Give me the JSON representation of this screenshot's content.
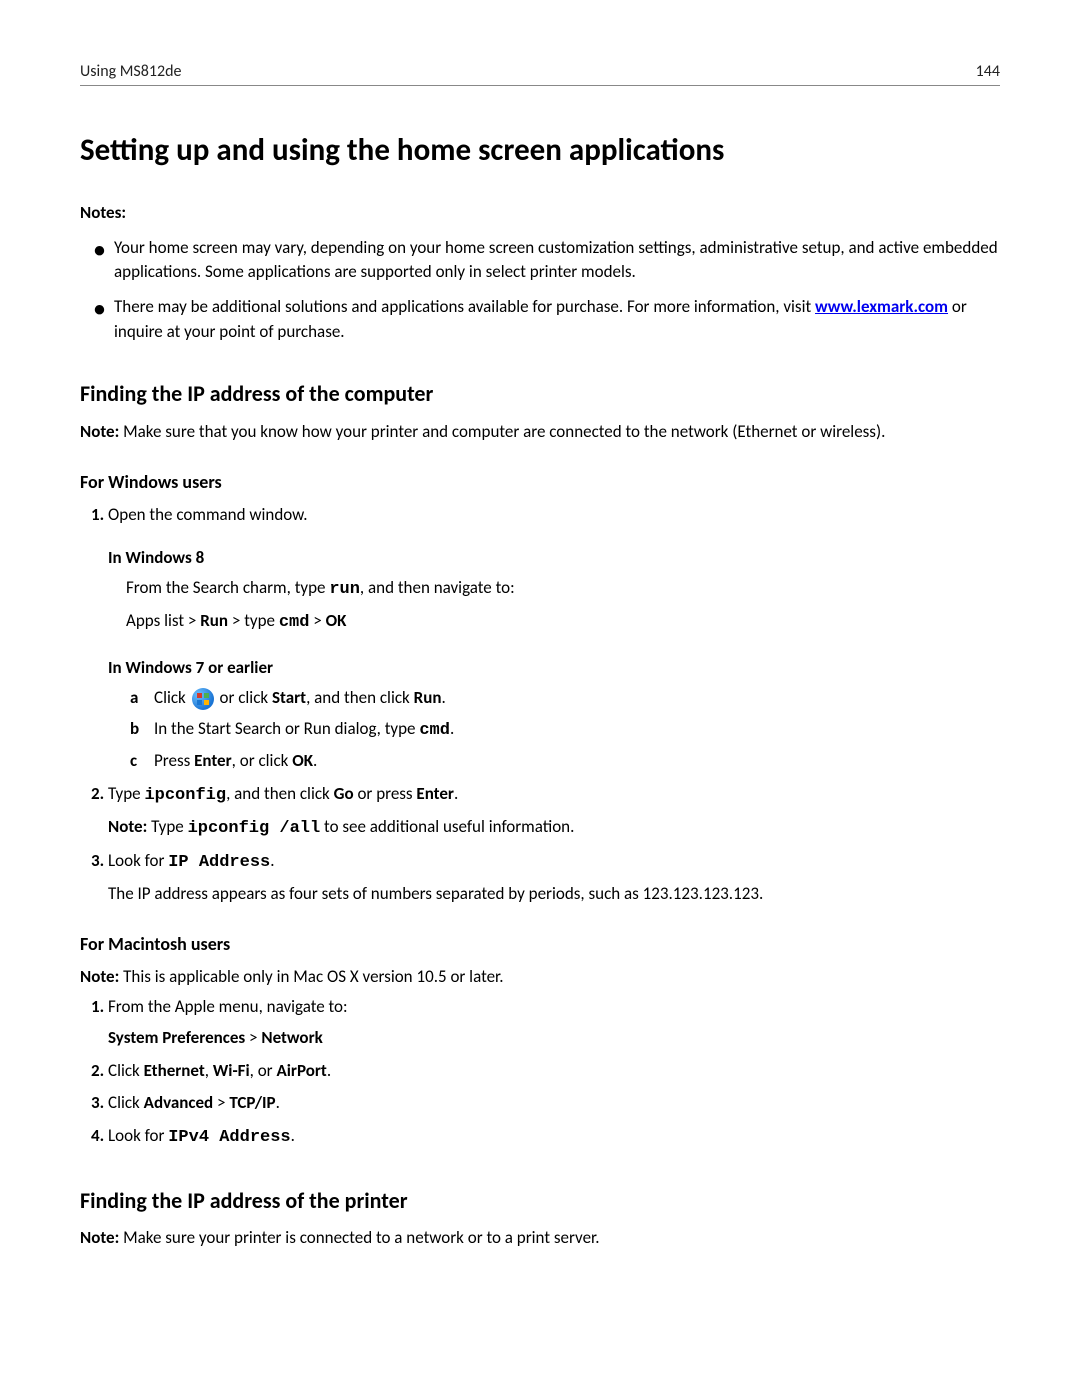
{
  "header": {
    "left": "Using MS812de",
    "right": "144"
  },
  "title": "Setting up and using the home screen applications",
  "notes_label": "Notes:",
  "notes": [
    "Your home screen may vary, depending on your home screen customization settings, administrative setup, and active embedded applications. Some applications are supported only in select printer models.",
    "There may be additional solutions and applications available for purchase. For more information, visit ",
    " or inquire at your point of purchase."
  ],
  "link": "www.lexmark.com",
  "s1": {
    "heading": "Finding the IP address of the computer",
    "note_label": "Note:",
    "note_text": " Make sure that you know how your printer and computer are connected to the network (Ethernet or wireless).",
    "win_heading": "For Windows users",
    "win_step1": "Open the command window.",
    "win8_heading": "In Windows 8",
    "win8_line1a": "From the Search charm, type ",
    "win8_run": "run",
    "win8_line1b": ", and then navigate to:",
    "win8_line2a": "Apps list > ",
    "win8_Run": "Run",
    "win8_gt1": " > type ",
    "win8_cmd": "cmd",
    "win8_gt2": " > ",
    "win8_OK": "OK",
    "win7_heading": "In Windows 7 or earlier",
    "win7_a_pre": "Click ",
    "win7_a_mid": " or click ",
    "win7_Start": "Start",
    "win7_a_mid2": ", and then click ",
    "win7_Run": "Run",
    "win7_a_end": ".",
    "win7_b_pre": "In the Start Search or Run dialog, type ",
    "win7_b_cmd": "cmd",
    "win7_b_end": ".",
    "win7_c_pre": "Press ",
    "win7_Enter": "Enter",
    "win7_c_mid": ", or click ",
    "win7_OK": "OK",
    "win7_c_end": ".",
    "step2_pre": "Type ",
    "step2_ip": "ipconfig",
    "step2_mid": ", and then click ",
    "step2_Go": "Go",
    "step2_mid2": " or press ",
    "step2_Enter": "Enter",
    "step2_end": ".",
    "step2_note_label": "Note:",
    "step2_note_pre": " Type ",
    "step2_note_cmd": "ipconfig /all",
    "step2_note_post": " to see additional useful information.",
    "step3_pre": "Look for ",
    "step3_ip": "IP Address",
    "step3_end": ".",
    "step3_line2": "The IP address appears as four sets of numbers separated by periods, such as 123.123.123.123.",
    "mac_heading": "For Macintosh users",
    "mac_note_label": "Note:",
    "mac_note_text": " This is applicable only in Mac OS X version 10.5 or later.",
    "mac1": "From the Apple menu, navigate to:",
    "mac1_sp": "System Preferences",
    "mac1_gt": " > ",
    "mac1_net": "Network",
    "mac2_pre": "Click ",
    "mac2_eth": "Ethernet",
    "mac2_c1": ", ",
    "mac2_wifi": "Wi-Fi",
    "mac2_c2": ", or ",
    "mac2_air": "AirPort",
    "mac2_end": ".",
    "mac3_pre": "Click ",
    "mac3_adv": "Advanced",
    "mac3_gt": " > ",
    "mac3_tcp": "TCP/IP",
    "mac3_end": ".",
    "mac4_pre": "Look for ",
    "mac4_ip": "IPv4 Address",
    "mac4_end": "."
  },
  "s2": {
    "heading": "Finding the IP address of the printer",
    "note_label": "Note:",
    "note_text": " Make sure your printer is connected to a network or to a print server."
  },
  "labels": {
    "a": "a",
    "b": "b",
    "c": "c"
  }
}
